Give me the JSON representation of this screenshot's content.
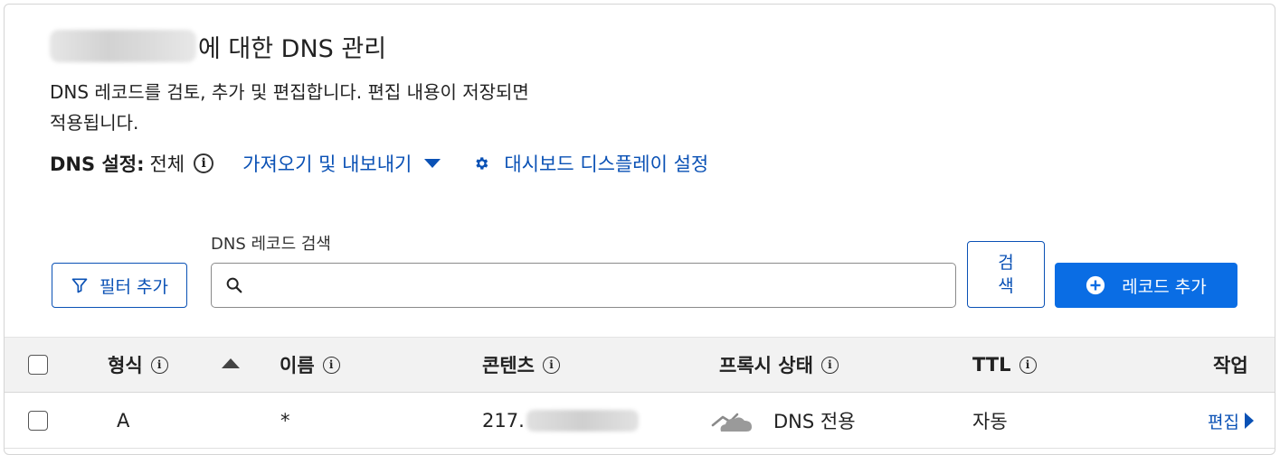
{
  "header": {
    "title_suffix": "에 대한 DNS 관리",
    "description": "DNS 레코드를 검토, 추가 및 편집합니다. 편집 내용이 저장되면 적용됩니다."
  },
  "settings": {
    "label": "DNS 설정:",
    "value": "전체",
    "import_export": "가져오기 및 내보내기",
    "dashboard_display": "대시보드 디스플레이 설정"
  },
  "toolbar": {
    "filter_label": "필터 추가",
    "search_label": "DNS 레코드 검색",
    "search_value": "",
    "search_button": "검색",
    "add_record": "레코드 추가"
  },
  "table": {
    "columns": [
      "형식",
      "이름",
      "콘텐츠",
      "프록시 상태",
      "TTL",
      "작업"
    ],
    "rows": [
      {
        "type": "A",
        "name": "*",
        "content": "217.",
        "proxy": "DNS 전용",
        "ttl": "자동",
        "action": "편집"
      }
    ]
  },
  "colors": {
    "accent": "#0a51b5",
    "primary_button": "#0a6de4",
    "header_bg": "#f2f2f2"
  },
  "icons": [
    "info-icon",
    "caret-down-icon",
    "gear-icon",
    "filter-icon",
    "search-icon",
    "plus-circle-icon",
    "sort-up-icon",
    "cloud-icon",
    "caret-right-icon"
  ]
}
